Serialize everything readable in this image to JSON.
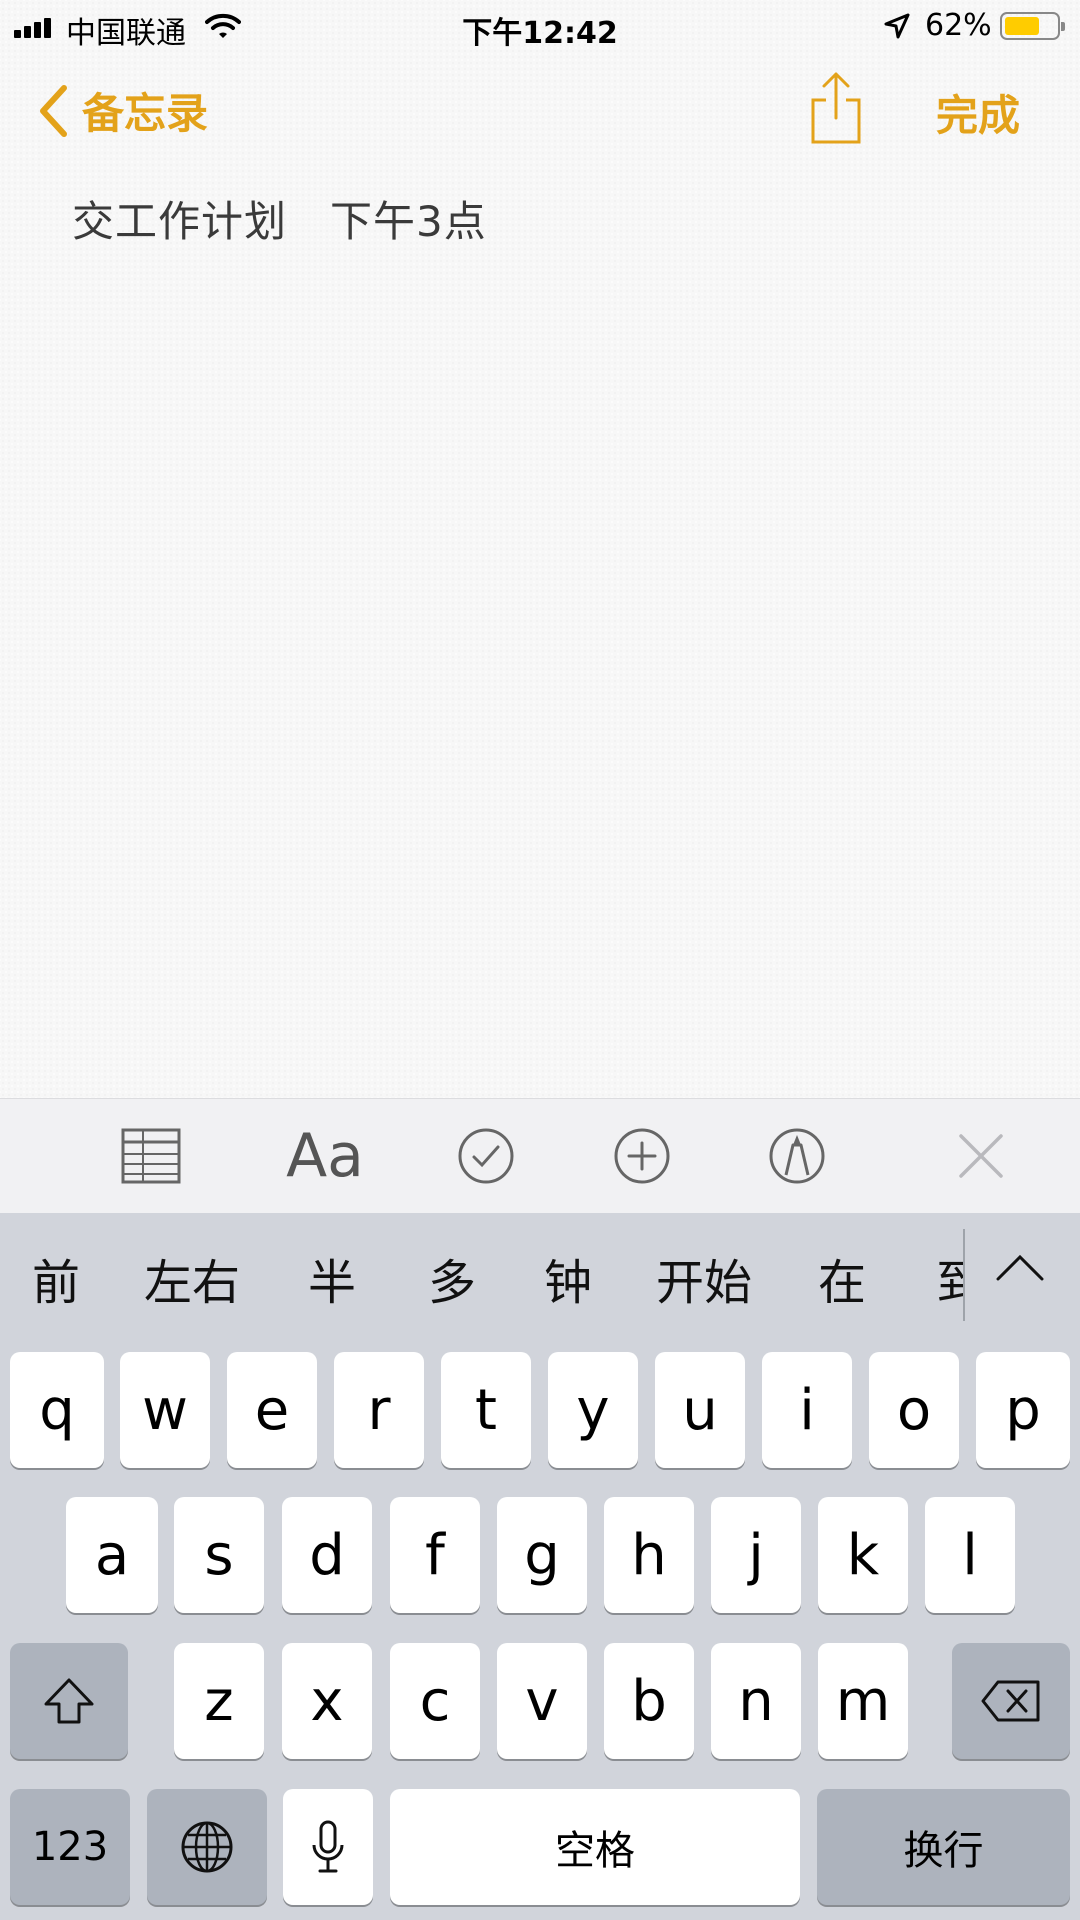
{
  "status": {
    "carrier": "中国联通",
    "time": "下午12:42",
    "battery": "62%",
    "battery_level": 0.62
  },
  "nav": {
    "back_label": "备忘录",
    "done_label": "完成",
    "accent": "#e3a21a"
  },
  "note": {
    "content": "交工作计划   下午3点"
  },
  "toolbar": {
    "format_label": "Aa",
    "items": [
      "table-icon",
      "format-text",
      "checklist-icon",
      "add-icon",
      "markup-icon",
      "close-icon"
    ]
  },
  "keyboard": {
    "candidates": [
      "前",
      "左右",
      "半",
      "多",
      "钟",
      "开始",
      "在",
      "到"
    ],
    "row1": [
      "q",
      "w",
      "e",
      "r",
      "t",
      "y",
      "u",
      "i",
      "o",
      "p"
    ],
    "row2": [
      "a",
      "s",
      "d",
      "f",
      "g",
      "h",
      "j",
      "k",
      "l"
    ],
    "row3": [
      "z",
      "x",
      "c",
      "v",
      "b",
      "n",
      "m"
    ],
    "numbers_label": "123",
    "space_label": "空格",
    "return_label": "换行"
  }
}
